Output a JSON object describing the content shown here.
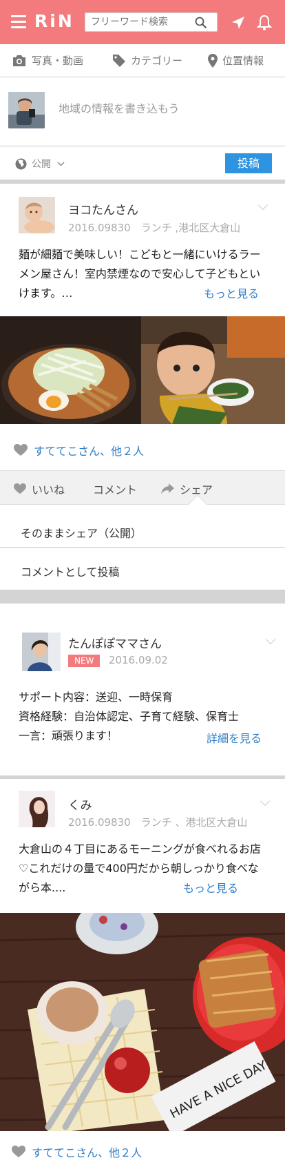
{
  "header": {
    "logo": "RiN",
    "search_placeholder": "フリーワード検索"
  },
  "tabs": [
    {
      "label": "写真・動画",
      "icon": "camera-icon"
    },
    {
      "label": "カテゴリー",
      "icon": "tag-icon"
    },
    {
      "label": "位置情報",
      "icon": "location-pin-icon"
    }
  ],
  "compose": {
    "placeholder": "地域の情報を書き込もう",
    "visibility": "公開",
    "post_button": "投稿"
  },
  "posts": [
    {
      "user": "ヨコたんさん",
      "meta": "2016.09830　ランチ ,港北区大倉山",
      "body": "麺が細麺で美味しい！こどもと一緒にいけるラーメン屋さん！室内禁煙なので安心して子どもといけます。…",
      "more": "もっと見る",
      "likes": "すててこさん、他２人"
    },
    {
      "user": "たんぽぽママさん",
      "badge": "NEW",
      "meta": "2016.09.02",
      "body_lines": [
        "サポート内容：送迎、一時保育",
        "資格経験：自治体認定、子育て経験、保育士",
        "一言：頑張ります！"
      ],
      "more": "詳細を見る"
    },
    {
      "user": "くみ",
      "meta": "2016.09830　ランチ 、港北区大倉山",
      "body": "大倉山の４丁目にあるモーニングが食べれるお店♡これだけの量で400円だから朝しっかり食べながら本....",
      "more": "もっと見る",
      "likes": "すててこさん、他２人"
    }
  ],
  "actions": {
    "like": "いいね",
    "comment": "コメント",
    "share": "シェア"
  },
  "share_menu": [
    "そのままシェア（公開）",
    "コメントとして投稿"
  ],
  "photo_text": "HAVE A NICE DAY",
  "colors": {
    "brand": "#f37a7d",
    "accent": "#2e93e0",
    "link": "#2e7ec9"
  }
}
